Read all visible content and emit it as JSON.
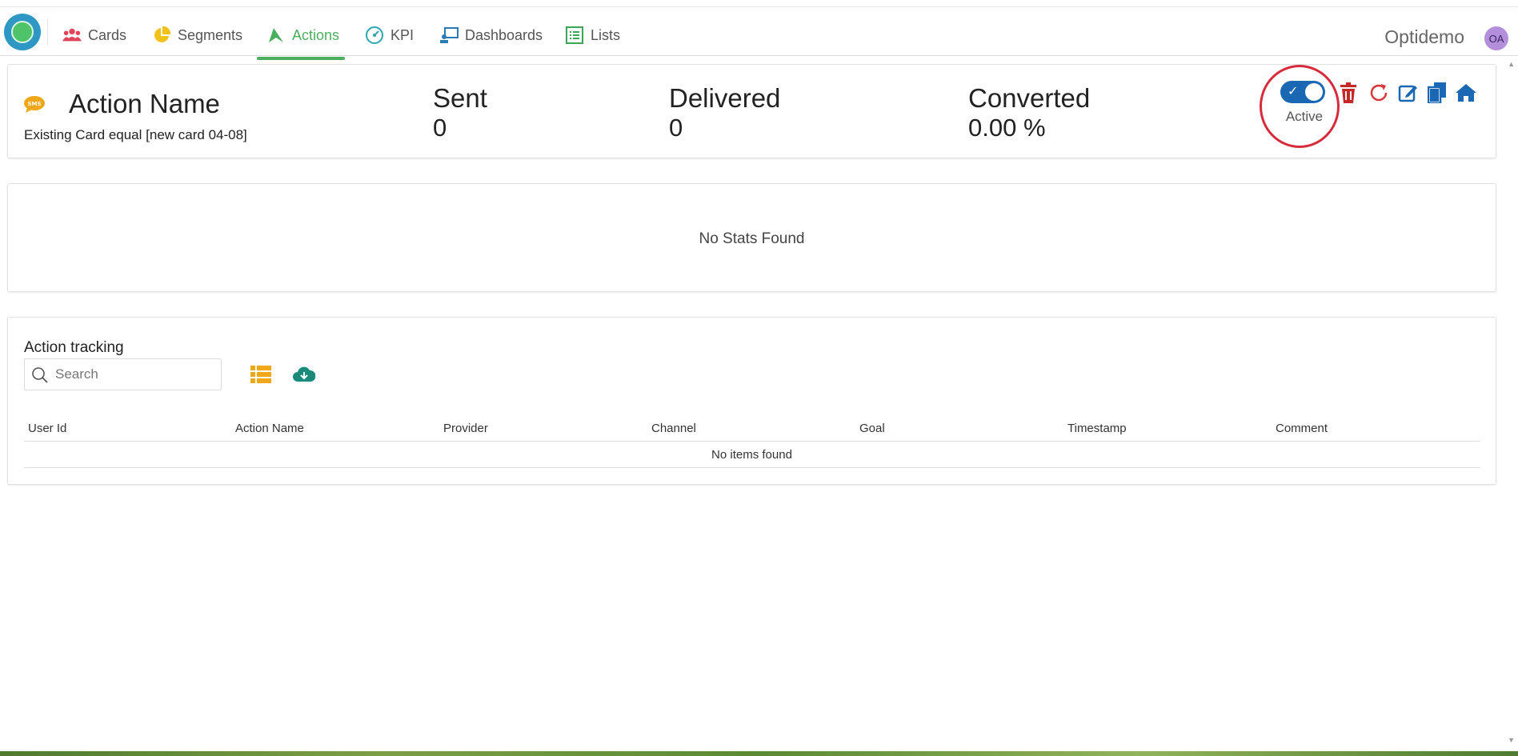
{
  "nav": {
    "items": [
      {
        "label": "Cards",
        "icon": "users-icon"
      },
      {
        "label": "Segments",
        "icon": "pie-chart-icon"
      },
      {
        "label": "Actions",
        "icon": "paper-plane-icon",
        "active": true
      },
      {
        "label": "KPI",
        "icon": "gauge-icon"
      },
      {
        "label": "Dashboards",
        "icon": "dashboard-icon"
      },
      {
        "label": "Lists",
        "icon": "list-icon"
      }
    ],
    "brand": "Optidemo",
    "avatar_initials": "OA"
  },
  "action": {
    "title": "Action Name",
    "subtitle": "Existing Card equal [new card 04-08]",
    "channel_icon": "sms-icon",
    "metrics": [
      {
        "label": "Sent",
        "value": "0"
      },
      {
        "label": "Delivered",
        "value": "0"
      },
      {
        "label": "Converted",
        "value": "0.00 %"
      }
    ],
    "toggle_label": "Active",
    "toggle_on": true,
    "tools": [
      "delete-icon",
      "refresh-icon",
      "edit-icon",
      "copy-icon",
      "home-icon"
    ]
  },
  "stats": {
    "empty_text": "No Stats Found"
  },
  "tracking": {
    "title": "Action tracking",
    "search_placeholder": "Search",
    "columns": [
      "User Id",
      "Action Name",
      "Provider",
      "Channel",
      "Goal",
      "Timestamp",
      "Comment"
    ],
    "empty_text": "No items found"
  },
  "colors": {
    "accent_green": "#4caf5f",
    "primary_blue": "#1a67b3",
    "danger_red": "#c62828",
    "highlight_ring": "#d62b3a",
    "sms_orange": "#f0a818"
  }
}
